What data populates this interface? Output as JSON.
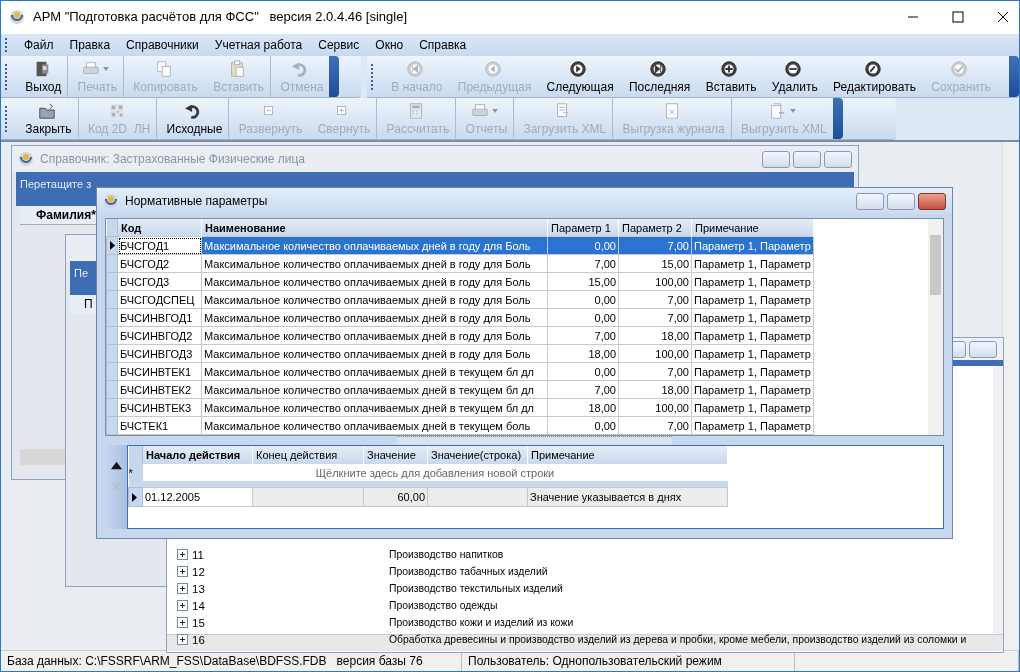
{
  "window": {
    "title": "АРМ \"Подготовка расчётов для ФСС\"   версия 2.0.4.46 [single]"
  },
  "menu": [
    "Файл",
    "Правка",
    "Справочники",
    "Учетная работа",
    "Сервис",
    "Окно",
    "Справка"
  ],
  "toolbar_1": [
    {
      "label": "Выход",
      "disabled": false,
      "dropdown": false
    },
    {
      "label": "Печать",
      "disabled": true,
      "dropdown": true
    },
    {
      "label": "Копировать",
      "disabled": true,
      "dropdown": false
    },
    {
      "label": "Вставить",
      "disabled": true,
      "dropdown": false
    },
    {
      "label": "Отмена",
      "disabled": true,
      "dropdown": false
    }
  ],
  "toolbar_2": [
    {
      "label": "В начало",
      "disabled": true,
      "dropdown": false
    },
    {
      "label": "Предыдущая",
      "disabled": true,
      "dropdown": false
    },
    {
      "label": "Следующая",
      "disabled": false,
      "dropdown": false
    },
    {
      "label": "Последняя",
      "disabled": false,
      "dropdown": false
    },
    {
      "label": "Вставить",
      "disabled": false,
      "dropdown": false
    },
    {
      "label": "Удалить",
      "disabled": false,
      "dropdown": false
    },
    {
      "label": "Редактировать",
      "disabled": false,
      "dropdown": false
    },
    {
      "label": "Сохранить",
      "disabled": true,
      "dropdown": false
    }
  ],
  "toolbar_3": [
    {
      "label": "Закрыть",
      "disabled": false,
      "dropdown": false
    },
    {
      "label": "Код 2D  ЛН",
      "disabled": true,
      "dropdown": false
    },
    {
      "label": "Исходные",
      "disabled": false,
      "dropdown": false
    },
    {
      "label": "Развернуть",
      "disabled": true,
      "dropdown": false
    },
    {
      "label": "Свернуть",
      "disabled": true,
      "dropdown": false
    },
    {
      "label": "Рассчитать",
      "disabled": true,
      "dropdown": false
    },
    {
      "label": "Отчеты",
      "disabled": true,
      "dropdown": true
    },
    {
      "label": "Загрузить XML",
      "disabled": true,
      "dropdown": false
    },
    {
      "label": "Выгрузка журнала",
      "disabled": true,
      "dropdown": false
    },
    {
      "label": "Выгрузить XML",
      "disabled": true,
      "dropdown": true
    }
  ],
  "back_window_1": {
    "title": "Справочник: Застрахованные Физические лица",
    "group_hint": "Перетащите з",
    "column_1": "Фамилия*"
  },
  "back_window_2": {
    "group_hint": "Пе",
    "column_1": "П"
  },
  "back_window_3": {
    "rows": [
      {
        "code": "11",
        "name": "Производство напитков",
        "expanded": false
      },
      {
        "code": "12",
        "name": "Производство табачных изделий",
        "expanded": false
      },
      {
        "code": "13",
        "name": "Производство текстильных изделий",
        "expanded": false
      },
      {
        "code": "14",
        "name": "Производство одежды",
        "expanded": false
      },
      {
        "code": "15",
        "name": "Производство кожи и изделий из кожи",
        "expanded": false
      },
      {
        "code": "16",
        "name": "Обработка древесины и производство изделий из дерева и пробки, кроме мебели, производство изделий из соломки и",
        "expanded": false
      }
    ]
  },
  "dialog": {
    "title": "Нормативные параметры",
    "table": {
      "columns": [
        "Код",
        "Наименование",
        "Параметр 1",
        "Параметр 2",
        "Примечание"
      ],
      "rows": [
        {
          "selected": true,
          "cells": [
            "БЧСГОД1",
            "Максимальное количество оплачиваемых дней в году для Боль",
            "0,00",
            "7,00",
            "Параметр 1, Параметр"
          ]
        },
        {
          "selected": false,
          "cells": [
            "БЧСГОД2",
            "Максимальное количество оплачиваемых дней в году для Боль",
            "7,00",
            "15,00",
            "Параметр 1, Параметр"
          ]
        },
        {
          "selected": false,
          "cells": [
            "БЧСГОД3",
            "Максимальное количество оплачиваемых дней в году для Боль",
            "15,00",
            "100,00",
            "Параметр 1, Параметр"
          ]
        },
        {
          "selected": false,
          "cells": [
            "БЧСГОДСПЕЦ",
            "Максимальное количество оплачиваемых дней в году для Боль",
            "0,00",
            "7,00",
            "Параметр 1, Параметр"
          ]
        },
        {
          "selected": false,
          "cells": [
            "БЧСИНВГОД1",
            "Максимальное количество оплачиваемых дней в году для Боль",
            "0,00",
            "7,00",
            "Параметр 1, Параметр"
          ]
        },
        {
          "selected": false,
          "cells": [
            "БЧСИНВГОД2",
            "Максимальное количество оплачиваемых дней в году для Боль",
            "7,00",
            "18,00",
            "Параметр 1, Параметр"
          ]
        },
        {
          "selected": false,
          "cells": [
            "БЧСИНВГОД3",
            "Максимальное количество оплачиваемых дней в году для Боль",
            "18,00",
            "100,00",
            "Параметр 1, Параметр"
          ]
        },
        {
          "selected": false,
          "cells": [
            "БЧСИНВТЕК1",
            "Максимальное количество оплачиваемых дней в текущем бл дл",
            "0,00",
            "7,00",
            "Параметр 1, Параметр"
          ]
        },
        {
          "selected": false,
          "cells": [
            "БЧСИНВТЕК2",
            "Максимальное количество оплачиваемых дней в текущем бл дл",
            "7,00",
            "18,00",
            "Параметр 1, Параметр"
          ]
        },
        {
          "selected": false,
          "cells": [
            "БЧСИНВТЕК3",
            "Максимальное количество оплачиваемых дней в текущем бл дл",
            "18,00",
            "100,00",
            "Параметр 1, Параметр"
          ]
        },
        {
          "selected": false,
          "cells": [
            "БЧСТЕК1",
            "Максимальное количество оплачиваемых дней в текущем боль",
            "0,00",
            "7,00",
            "Параметр 1, Параметр"
          ]
        }
      ]
    },
    "detail": {
      "columns": [
        "Начало действия",
        "Конец действия",
        "Значение",
        "Значение(строка)",
        "Примечание"
      ],
      "new_row_hint": "Щёлкните здесь для добавления новой строки",
      "new_row_marker": "*",
      "rows": [
        {
          "start": "01.12.2005",
          "value": "60,00",
          "note": "Значение указывается в днях",
          "selected": true
        }
      ]
    }
  },
  "status_bar": {
    "database": "База данных: C:\\FSSRF\\ARM_FSS\\DataBase\\BDFSS.FDB",
    "db_version": "версия базы 76",
    "user": "Пользователь: Однопользовательский режим"
  }
}
